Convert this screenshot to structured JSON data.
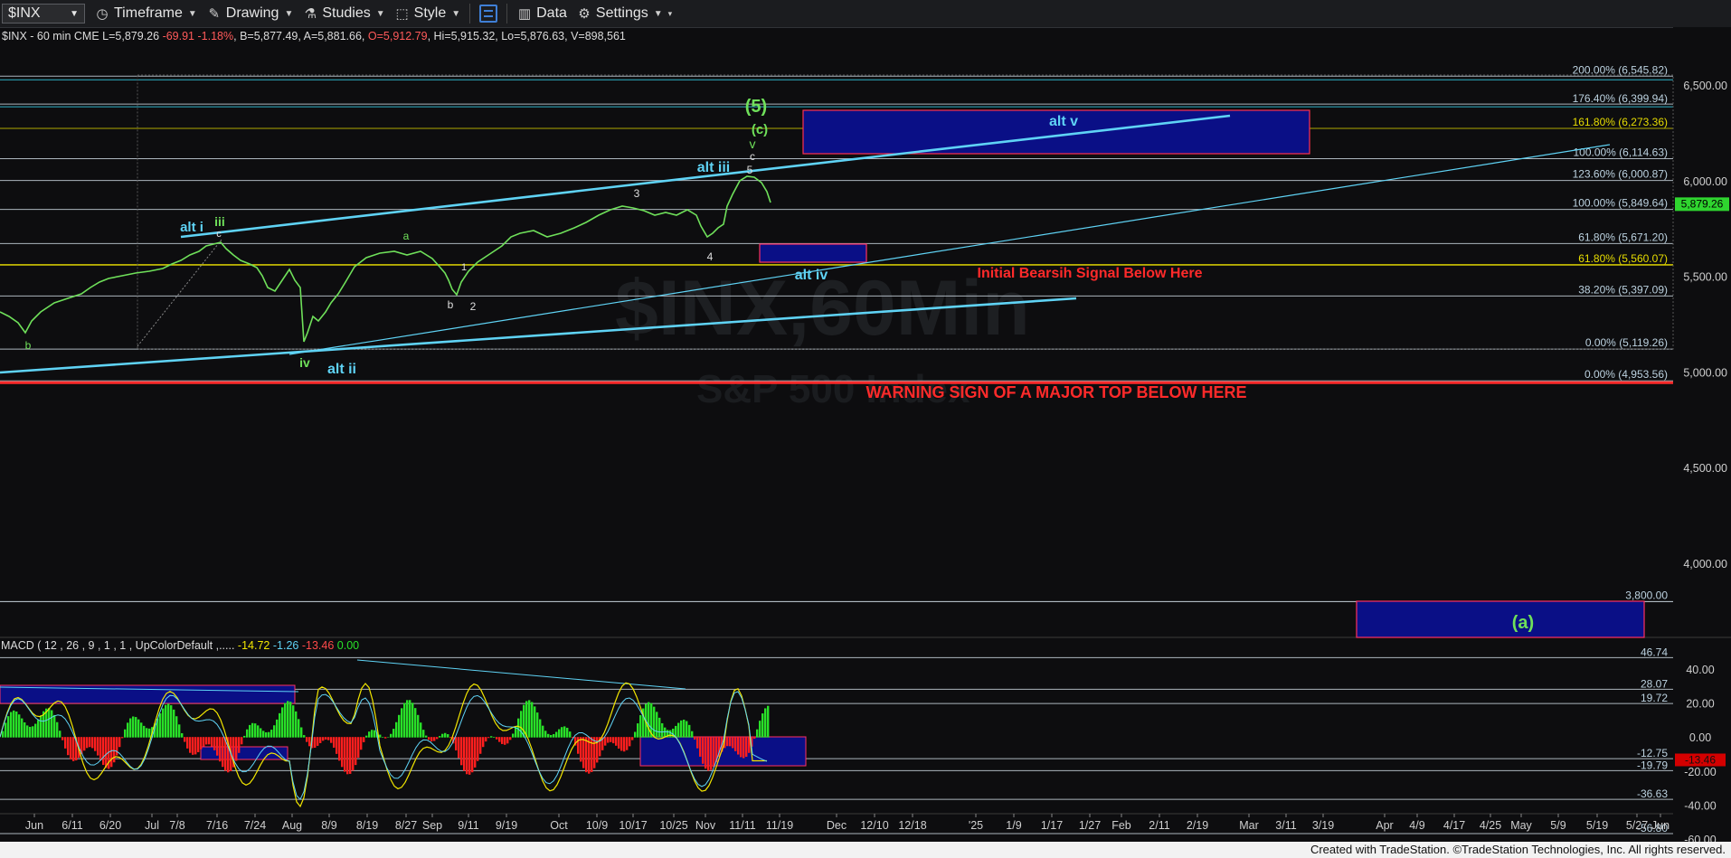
{
  "toolbar": {
    "symbol": "$INX",
    "timeframe_label": "Timeframe",
    "drawing_label": "Drawing",
    "studies_label": "Studies",
    "style_label": "Style",
    "data_label": "Data",
    "settings_label": "Settings"
  },
  "icons": [
    "clock-icon",
    "drawing-icon",
    "studies-icon",
    "style-icon",
    "layout-icon",
    "data-icon",
    "gear-icon"
  ],
  "info": {
    "symbol_desc": "$INX - 60 min  CME",
    "last": "L=5,879.26",
    "change": "-69.91",
    "change_pct": "-1.18%",
    "bid": "B=5,877.49",
    "ask": "A=5,881.66",
    "open": "O=5,912.79",
    "high": "Hi=5,915.32",
    "low": "Lo=5,876.63",
    "volume": "V=898,561"
  },
  "macd_info": {
    "label": "MACD ( 12 , 26 , 9 , 1 , 1 , UpColorDefault ,.....",
    "v1": "-14.72",
    "v2": "-1.26",
    "v3": "-13.46",
    "v4": "0.00"
  },
  "colors": {
    "price_line": "#6fe05a",
    "cyan": "#5fd3f5",
    "yellow": "#f2e600",
    "red": "#ff2a2a",
    "blue_box": "#0a0f86",
    "macd_hist_up": "#28e028",
    "macd_hist_down": "#ff1e1e"
  },
  "chart_data": [
    {
      "type": "line",
      "title": "$INX - 60 min",
      "ylim": [
        3560,
        6620
      ],
      "y_ticks": [
        "6,500.00",
        "6,000.00",
        "5,500.00",
        "5,000.00",
        "4,500.00",
        "4,000.00"
      ],
      "y_tick_values": [
        6500,
        6000,
        5500,
        5000,
        4500,
        4000
      ],
      "last_price_label": "5,879.26",
      "last_price": 5879.26,
      "x_ticks": [
        "Jun",
        "6/11",
        "6/20",
        "Jul",
        "7/8",
        "7/16",
        "7/24",
        "Aug",
        "8/9",
        "8/19",
        "8/27",
        "Sep",
        "9/11",
        "9/19",
        "Oct",
        "10/9",
        "10/17",
        "10/25",
        "Nov",
        "11/11",
        "11/19",
        "Dec",
        "12/10",
        "12/18",
        "'25",
        "1/9",
        "1/17",
        "1/27",
        "Feb",
        "2/11",
        "2/19",
        "Mar",
        "3/11",
        "3/19",
        "Apr",
        "4/9",
        "4/17",
        "4/25",
        "May",
        "5/9",
        "5/19",
        "5/27",
        "Jun"
      ],
      "fib_levels": [
        {
          "label": "200.00% (6,545.82)",
          "value": 6545.82
        },
        {
          "label": "176.40% (6,399.94)",
          "value": 6399.94
        },
        {
          "label": "161.80% (6,273.36)",
          "value": 6273.36
        },
        {
          "label": "100.00% (6,114.63)",
          "value": 6114.63
        },
        {
          "label": "123.60% (6,000.87)",
          "value": 6000.87
        },
        {
          "label": "100.00% (5,849.64)",
          "value": 5849.64
        },
        {
          "label": "61.80% (5,671.20)",
          "value": 5671.2
        },
        {
          "label": "61.80% (5,560.07)",
          "value": 5560.07
        },
        {
          "label": "38.20% (5,397.09)",
          "value": 5397.09
        },
        {
          "label": "0.00% (5,119.26)",
          "value": 5119.26
        },
        {
          "label": "0.00% (4,953.56)",
          "value": 4953.56
        }
      ],
      "level_3800_label": "3,800.00",
      "level_3800": 3800,
      "wave_labels": [
        "(5)",
        "(c)",
        "v",
        "c",
        "5",
        "alt iii",
        "3",
        "4",
        "a",
        "b",
        "2",
        "1",
        "alt i",
        "iii",
        "c",
        "iv",
        "alt ii",
        "b",
        "alt iv",
        "alt v",
        "(a)"
      ],
      "annotations": [
        "Initial Bearsih Signal Below Here",
        "WARNING SIGN OF A MAJOR TOP BELOW HERE"
      ],
      "watermark": [
        "$INX,60Min",
        "S&P 500 Index"
      ]
    },
    {
      "type": "line",
      "title": "MACD ( 12 , 26 , 9 , 1 , 1 , UpColorDefault ,.....",
      "ylim": [
        -70,
        56
      ],
      "y_ticks": [
        "40.00",
        "20.00",
        "0.00",
        "-20.00",
        "-40.00",
        "-60.00"
      ],
      "y_tick_values": [
        40,
        20,
        0,
        -20,
        -40,
        -60
      ],
      "ref_levels": [
        {
          "label": "46.74",
          "value": 46.74
        },
        {
          "label": "28.07",
          "value": 28.07
        },
        {
          "label": "19.72",
          "value": 19.72
        },
        {
          "label": "-12.75",
          "value": -12.75
        },
        {
          "label": "-19.79",
          "value": -19.79
        },
        {
          "label": "-36.63",
          "value": -36.63
        },
        {
          "label": "-56.80",
          "value": -56.8
        }
      ],
      "last_value_label": "-13.46",
      "last_value": -13.46
    }
  ],
  "footer": "Created with TradeStation. ©TradeStation Technologies, Inc. All rights reserved."
}
